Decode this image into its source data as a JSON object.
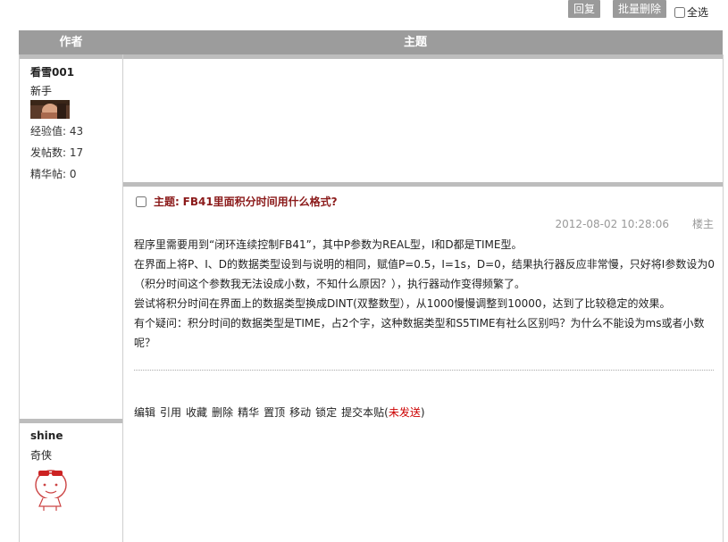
{
  "toolbar": {
    "reply_label": "回复",
    "batch_delete_label": "批量删除",
    "select_all_label": "全选"
  },
  "table_header": {
    "author": "作者",
    "topic": "主题"
  },
  "authors": [
    {
      "name": "看雪001",
      "rank": "新手",
      "stats": [
        "经验值: 43",
        "发帖数: 17",
        "精华帖: 0"
      ]
    },
    {
      "name": "shine",
      "rank": "奇侠"
    }
  ],
  "post": {
    "subject_label": "主题:",
    "subject": "FB41里面积分时间用什么格式?",
    "date": "2012-08-02 10:28:06",
    "floor": "楼主",
    "paragraphs": [
      "程序里需要用到“闭环连续控制FB41”，其中P参数为REAL型，I和D都是TIME型。",
      " 在界面上将P、I、D的数据类型设到与说明的相同，赋值P=0.5，I=1s，D=0，结果执行器反应非常慢，只好将I参数设为0（积分时间这个参数我无法设成小数，不知什么原因？），执行器动作变得频繁了。",
      " 尝试将积分时间在界面上的数据类型换成DINT(双整数型），从1000慢慢调整到10000，达到了比较稳定的效果。",
      " 有个疑问：积分时间的数据类型是TIME，占2个字，这种数据类型和S5TIME有社么区别吗？为什么不能设为ms或者小数呢？"
    ],
    "actions": [
      "编辑",
      "引用",
      "收藏",
      "删除",
      "精华",
      "置顶",
      "移动",
      "锁定",
      "提交本贴("
    ],
    "unsent": "未发送",
    "close_paren": ")"
  }
}
